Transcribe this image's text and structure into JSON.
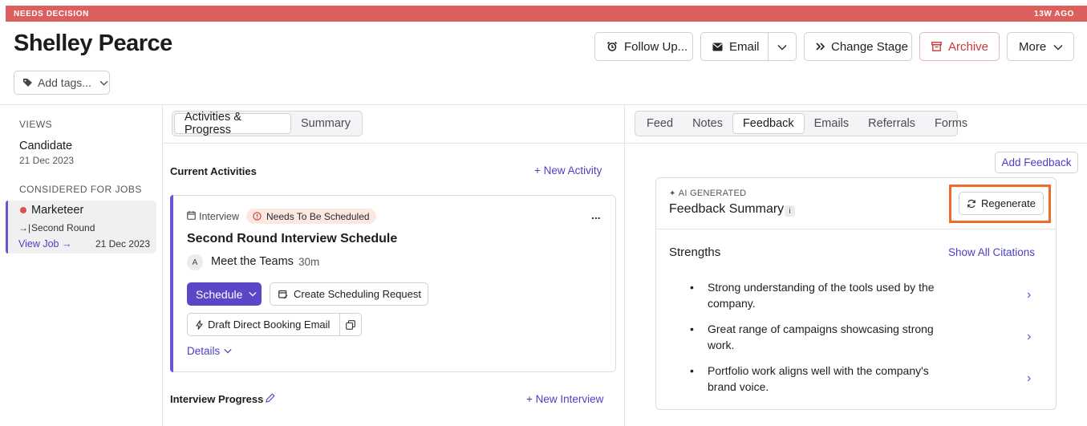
{
  "status_bar": {
    "label": "NEEDS DECISION",
    "age": "13W AGO",
    "color": "#dd5f5c"
  },
  "candidate": {
    "name": "Shelley Pearce"
  },
  "header_actions": {
    "follow_up": "Follow Up...",
    "email": "Email",
    "change_stage": "Change Stage",
    "archive": "Archive",
    "more": "More"
  },
  "tags": {
    "placeholder": "Add tags..."
  },
  "sidebar": {
    "views_heading": "VIEWS",
    "view_title": "Candidate",
    "view_date": "21 Dec 2023",
    "jobs_heading": "CONSIDERED FOR JOBS",
    "job": {
      "title": "Marketeer",
      "stage": "Second Round",
      "view_job": "View Job",
      "date": "21 Dec 2023"
    }
  },
  "center_tabs": [
    "Activities & Progress",
    "Summary"
  ],
  "activities": {
    "heading": "Current Activities",
    "new_activity": "+ New Activity",
    "card": {
      "type": "Interview",
      "badge": "Needs To Be Scheduled",
      "menu": "...",
      "title": "Second Round Interview Schedule",
      "avatar": "A",
      "meeting": "Meet the Teams",
      "duration": "30m",
      "schedule": "Schedule",
      "create_request": "Create Scheduling Request",
      "draft_email": "Draft Direct Booking Email",
      "details": "Details"
    },
    "progress_heading": "Interview Progress",
    "new_interview": "+ New Interview"
  },
  "right_tabs": [
    "Feed",
    "Notes",
    "Feedback",
    "Emails",
    "Referrals",
    "Forms"
  ],
  "feedback": {
    "add_feedback": "Add Feedback",
    "ai_label": "AI GENERATED",
    "title": "Feedback Summary",
    "info": "i",
    "regenerate": "Regenerate",
    "strengths_heading": "Strengths",
    "show_citations": "Show All Citations",
    "strengths": [
      "Strong understanding of the tools used by the company.",
      "Great range of campaigns showcasing strong work.",
      "Portfolio work aligns well with the company's brand voice."
    ]
  },
  "colors": {
    "accent": "#5a46c6",
    "archive": "#c8383b",
    "highlight": "#f06a2a"
  }
}
